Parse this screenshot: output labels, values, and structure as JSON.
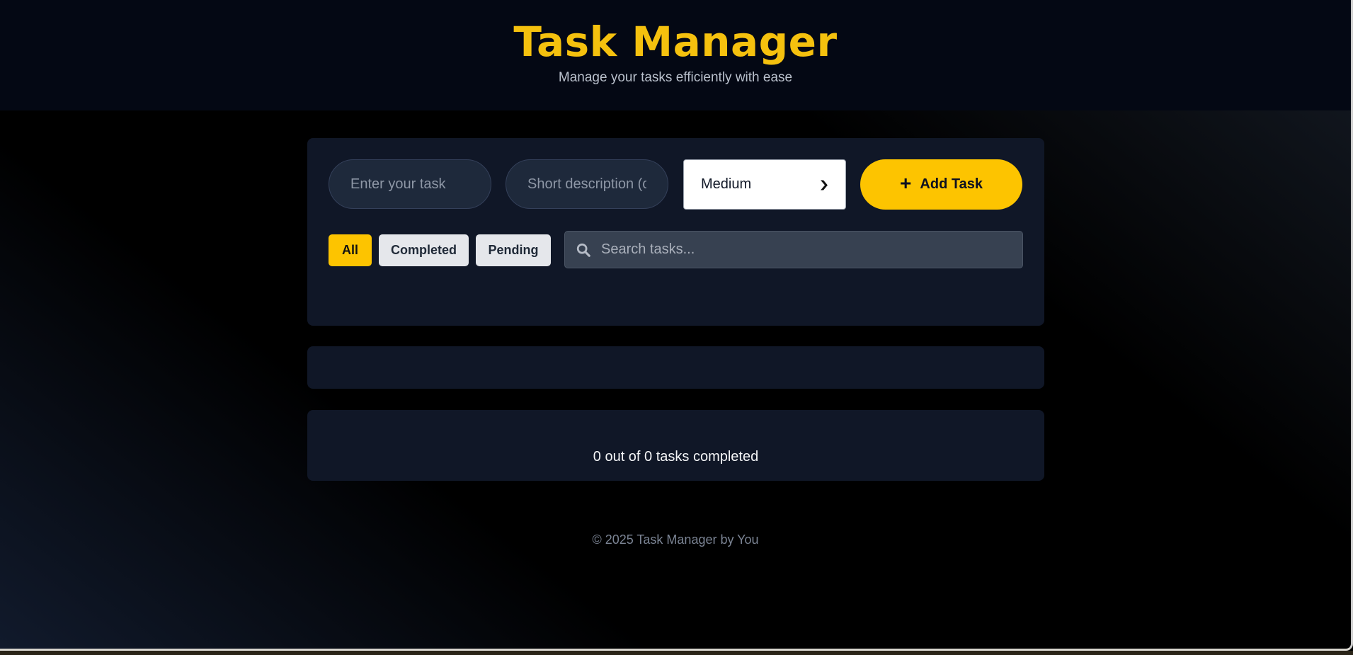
{
  "header": {
    "title": "Task Manager",
    "subtitle": "Manage your tasks efficiently with ease"
  },
  "form": {
    "task_placeholder": "Enter your task",
    "description_placeholder": "Short description (c",
    "priority_selected": "Medium",
    "add_button_label": "Add Task",
    "add_button_icon": "plus-icon"
  },
  "filters": {
    "all": "All",
    "completed": "Completed",
    "pending": "Pending",
    "active": "All"
  },
  "search": {
    "placeholder": "Search tasks...",
    "icon": "search-icon"
  },
  "stats": {
    "summary": "0 out of 0 tasks completed"
  },
  "footer": {
    "text": "© 2025 Task Manager by You"
  },
  "colors": {
    "accent": "#fdc400",
    "panel": "#101727",
    "header_bg": "#040814"
  }
}
